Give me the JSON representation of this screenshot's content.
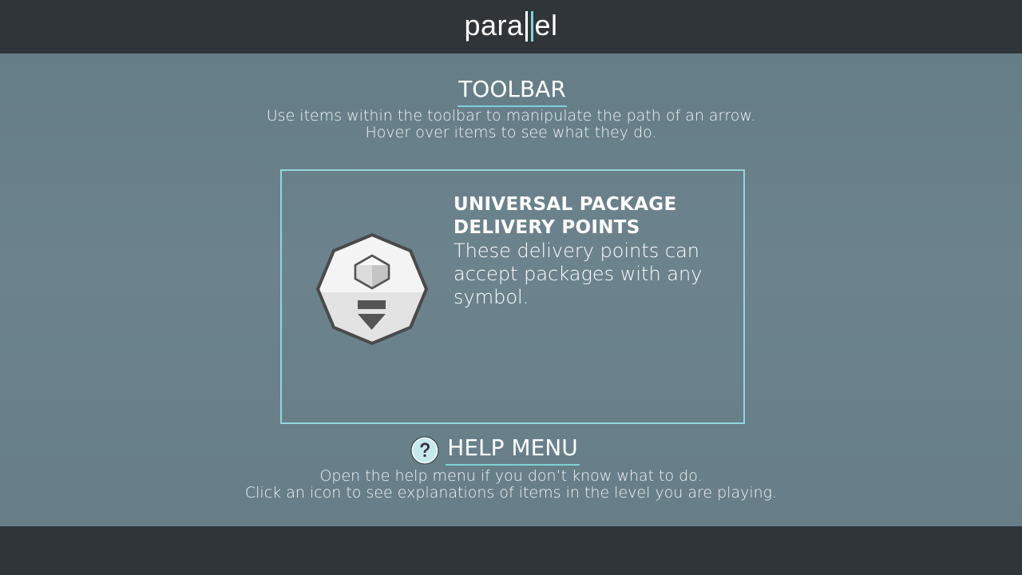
{
  "header": {
    "logo_prefix": "para",
    "logo_suffix": "el"
  },
  "toolbar_section": {
    "title": "TOOLBAR",
    "description_line1": "Use items within the toolbar to manipulate the path of an arrow.",
    "description_line2": "Hover over items to see what they do."
  },
  "item_panel": {
    "icon": "universal-delivery-point-icon",
    "title_line1": "UNIVERSAL PACKAGE",
    "title_line2": "DELIVERY POINTS",
    "description": "These delivery points can accept packages with any symbol."
  },
  "help_section": {
    "icon": "question-mark-icon",
    "title": "HELP MENU",
    "description_line1": "Open the help menu if you don’t know what to do.",
    "description_line2": "Click an icon to see explanations of items in the level you are playing."
  },
  "colors": {
    "accent": "#7fd0d8",
    "background": "#677e88",
    "bars": "#2f3539"
  }
}
